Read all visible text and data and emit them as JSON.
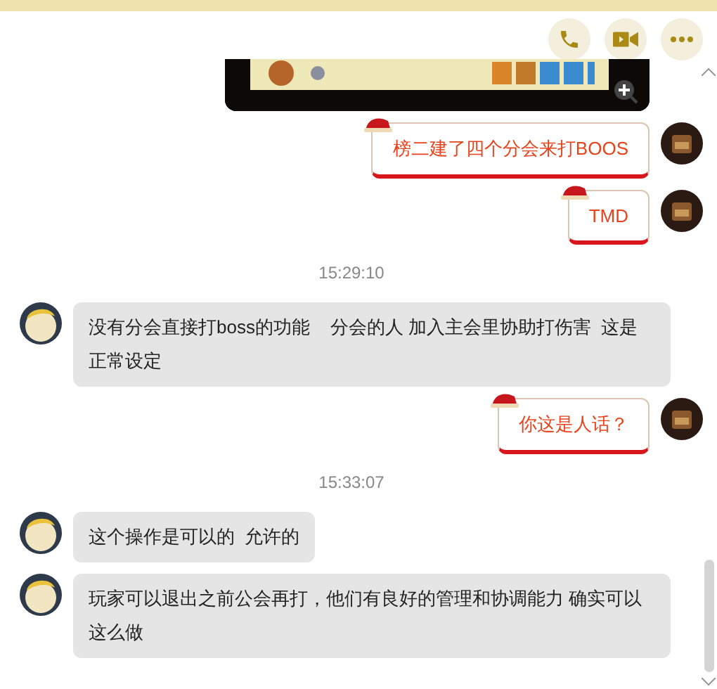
{
  "header": {
    "actions": [
      {
        "kind": "call"
      },
      {
        "kind": "video"
      },
      {
        "kind": "more"
      }
    ]
  },
  "messages": [
    {
      "kind": "sent_image"
    },
    {
      "kind": "sent",
      "text": "榜二建了四个分会来打BOOS"
    },
    {
      "kind": "sent",
      "text": "TMD"
    },
    {
      "kind": "time",
      "text": "15:29:10"
    },
    {
      "kind": "received",
      "text": "没有分会直接打boss的功能    分会的人 加入主会里协助打伤害  这是正常设定"
    },
    {
      "kind": "sent",
      "text": "你这是人话？"
    },
    {
      "kind": "time",
      "text": "15:33:07"
    },
    {
      "kind": "received",
      "text": "这个操作是可以的  允许的"
    },
    {
      "kind": "received",
      "text": "玩家可以退出之前公会再打，他们有良好的管理和协调能力 确实可以这么做"
    }
  ]
}
